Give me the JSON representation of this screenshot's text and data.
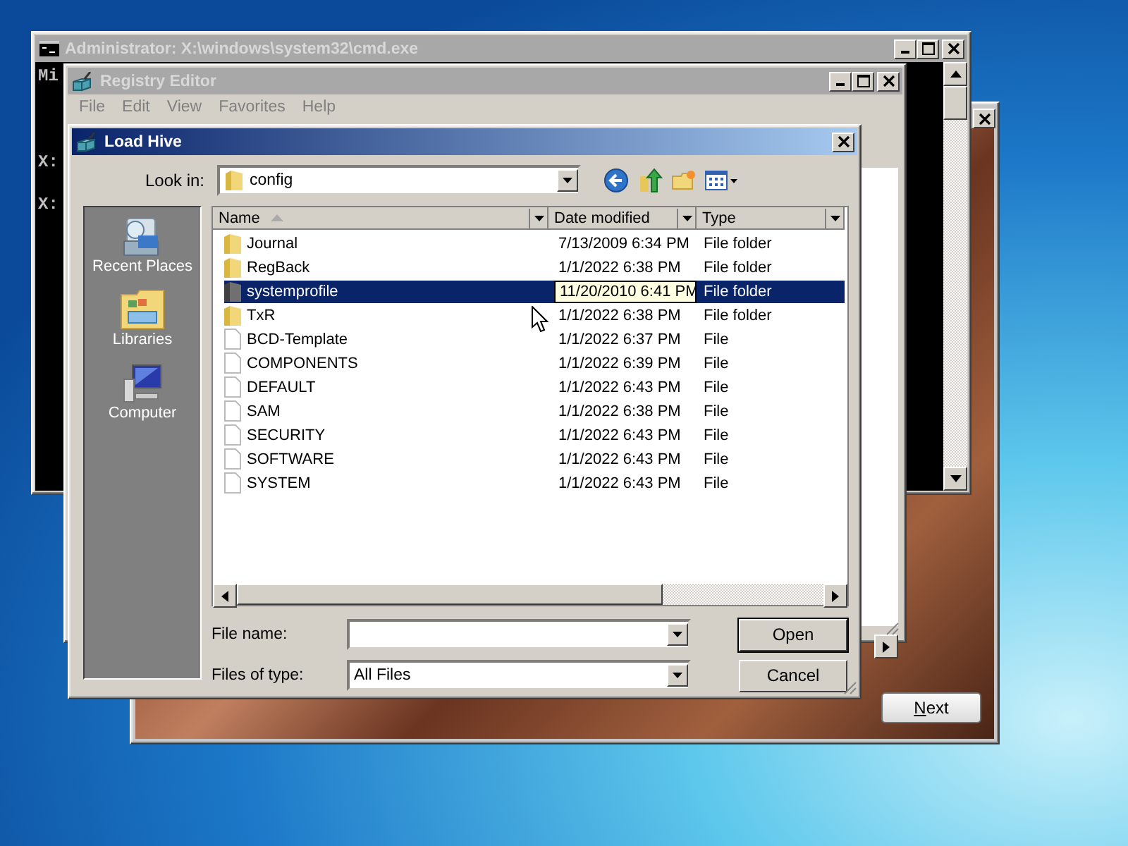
{
  "setup_window": {
    "next_button": "Next"
  },
  "cmd_window": {
    "title": "Administrator: X:\\windows\\system32\\cmd.exe",
    "console_lines": [
      "Mi",
      "X:",
      "X:"
    ]
  },
  "registry_editor": {
    "title": "Registry Editor",
    "menu": [
      "File",
      "Edit",
      "View",
      "Favorites",
      "Help"
    ]
  },
  "load_hive": {
    "title": "Load Hive",
    "look_in_label": "Look in:",
    "look_in_value": "config",
    "places": [
      {
        "label": "Recent Places",
        "kind": "recent"
      },
      {
        "label": "Libraries",
        "kind": "libraries"
      },
      {
        "label": "Computer",
        "kind": "computer"
      }
    ],
    "columns": [
      "Name",
      "Date modified",
      "Type"
    ],
    "rows": [
      {
        "name": "Journal",
        "date": "7/13/2009 6:34 PM",
        "type": "File folder",
        "kind": "folder",
        "selected": false
      },
      {
        "name": "RegBack",
        "date": "1/1/2022 6:38 PM",
        "type": "File folder",
        "kind": "folder",
        "selected": false
      },
      {
        "name": "systemprofile",
        "date": "11/20/2010 6:41 PM",
        "type": "File folder",
        "kind": "folder",
        "selected": true
      },
      {
        "name": "TxR",
        "date": "1/1/2022 6:38 PM",
        "type": "File folder",
        "kind": "folder",
        "selected": false
      },
      {
        "name": "BCD-Template",
        "date": "1/1/2022 6:37 PM",
        "type": "File",
        "kind": "file",
        "selected": false
      },
      {
        "name": "COMPONENTS",
        "date": "1/1/2022 6:39 PM",
        "type": "File",
        "kind": "file",
        "selected": false
      },
      {
        "name": "DEFAULT",
        "date": "1/1/2022 6:43 PM",
        "type": "File",
        "kind": "file",
        "selected": false
      },
      {
        "name": "SAM",
        "date": "1/1/2022 6:38 PM",
        "type": "File",
        "kind": "file",
        "selected": false
      },
      {
        "name": "SECURITY",
        "date": "1/1/2022 6:43 PM",
        "type": "File",
        "kind": "file",
        "selected": false
      },
      {
        "name": "SOFTWARE",
        "date": "1/1/2022 6:43 PM",
        "type": "File",
        "kind": "file",
        "selected": false
      },
      {
        "name": "SYSTEM",
        "date": "1/1/2022 6:43 PM",
        "type": "File",
        "kind": "file",
        "selected": false
      }
    ],
    "file_name_label": "File name:",
    "files_of_type_label": "Files of type:",
    "files_of_type_value": "All Files",
    "buttons": [
      "Open",
      "Cancel"
    ]
  }
}
